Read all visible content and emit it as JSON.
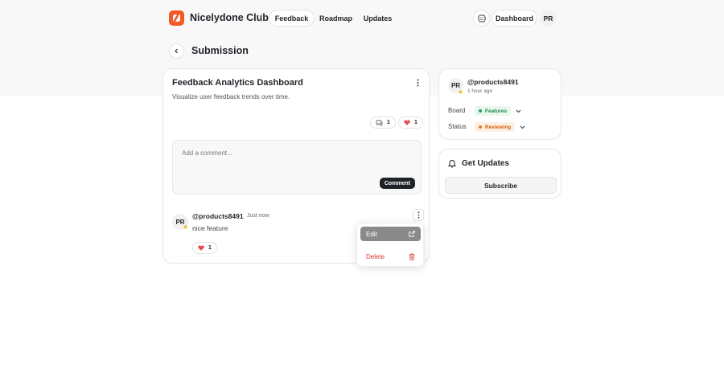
{
  "header": {
    "brand": "Nicelydone Club",
    "nav": [
      "Feedback",
      "Roadmap",
      "Updates"
    ],
    "dashboard_label": "Dashboard",
    "user_initials": "PR"
  },
  "page": {
    "title": "Submission"
  },
  "post": {
    "title": "Feedback Analytics Dashboard",
    "description": "Visualize user feedback trends over time.",
    "comment_count": "1",
    "like_count": "1"
  },
  "comment_box": {
    "placeholder": "Add a comment...",
    "button": "Comment"
  },
  "comment": {
    "initials": "PR",
    "user": "@products8491",
    "time": "Just now",
    "text": "nice feature",
    "likes": "1"
  },
  "sidebar": {
    "author_initials": "PR",
    "author": "@products8491",
    "time": "1 hour ago",
    "board_label": "Board",
    "board_value": "Features",
    "status_label": "Status",
    "status_value": "Reviewing",
    "updates_title": "Get Updates",
    "subscribe": "Subscribe"
  },
  "menu": {
    "edit": "Edit",
    "delete": "Delete"
  },
  "colors": {
    "brand": "#f15a24",
    "danger": "#d93a2b",
    "features": "#21a35a",
    "reviewing": "#f0741b"
  }
}
